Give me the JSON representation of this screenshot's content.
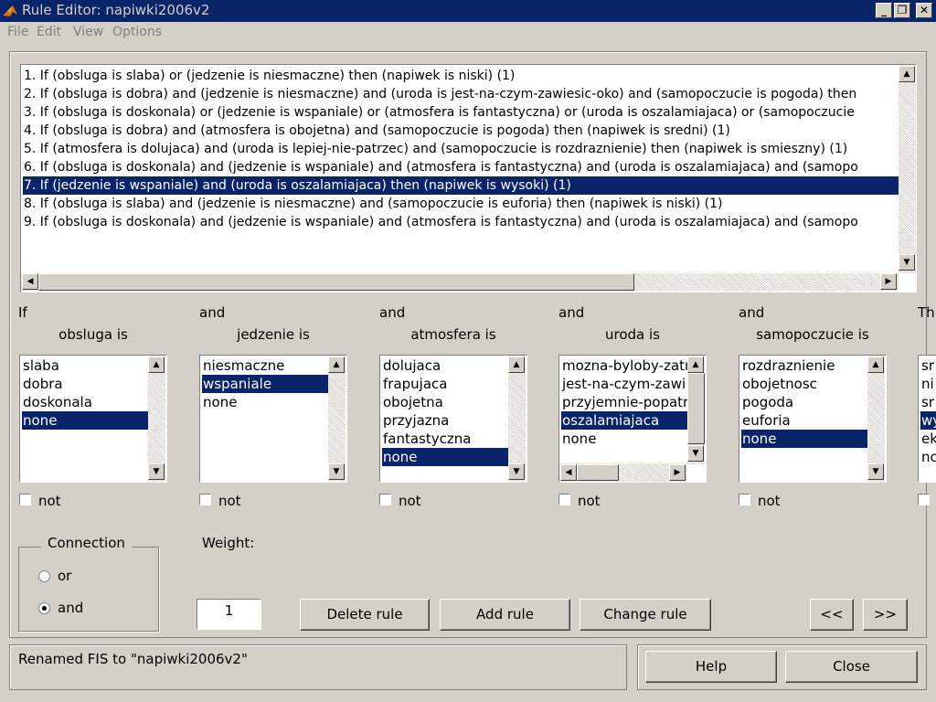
{
  "window": {
    "title": "Rule Editor: napiwki2006v2",
    "controls": [
      "minimize-icon",
      "restore-icon",
      "close-icon"
    ]
  },
  "menu": [
    "File",
    "Edit",
    "View",
    "Options"
  ],
  "rules": [
    "1. If (obsluga is slaba) or (jedzenie is niesmaczne) then (napiwek is niski) (1)",
    "2. If (obsluga is dobra) and (jedzenie is niesmaczne) and (uroda is jest-na-czym-zawiesic-oko) and (samopoczucie is pogoda) then",
    "3. If (obsluga is doskonala) or (jedzenie is wspaniale) or (atmosfera is fantastyczna) or (uroda is oszalamiajaca) or (samopoczucie",
    "4. If (obsluga is dobra) and (atmosfera is obojetna) and (samopoczucie is pogoda) then (napiwek is sredni) (1)",
    "5. If (atmosfera is dolujaca) and (uroda is lepiej-nie-patrzec) and (samopoczucie is rozdraznienie) then (napiwek is smieszny) (1)",
    "6. If (obsluga is doskonala) and (jedzenie is wspaniale) and (atmosfera is fantastyczna) and (uroda is oszalamiajaca) and (samopo",
    "7. If (jedzenie is wspaniale) and (uroda is oszalamiajaca) then (napiwek is wysoki) (1)",
    "8. If (obsluga is slaba) and (jedzenie is niesmaczne) and (samopoczucie is euforia) then (napiwek is niski) (1)",
    "9. If (obsluga is doskonala) and (jedzenie is wspaniale) and (atmosfera is fantastyczna) and (uroda is oszalamiajaca) and (samopo"
  ],
  "selected_rule_index": 6,
  "columns": [
    {
      "conn": "If",
      "label": "obsluga is",
      "options": [
        "slaba",
        "dobra",
        "doskonala",
        "none"
      ],
      "selected": 3,
      "not_label": "not"
    },
    {
      "conn": "and",
      "label": "jedzenie is",
      "options": [
        "niesmaczne",
        "wspaniale",
        "none"
      ],
      "selected": 1,
      "not_label": "not"
    },
    {
      "conn": "and",
      "label": "atmosfera is",
      "options": [
        "dolujaca",
        "frapujaca",
        "obojetna",
        "przyjazna",
        "fantastyczna",
        "none"
      ],
      "selected": 5,
      "not_label": "not"
    },
    {
      "conn": "and",
      "label": "uroda is",
      "options": [
        "mozna-byloby-zatr",
        "jest-na-czym-zawi",
        "przyjemnie-popatrz",
        "oszalamiajaca",
        "none"
      ],
      "selected": 3,
      "not_label": "not"
    },
    {
      "conn": "and",
      "label": "samopoczucie is",
      "options": [
        "rozdraznienie",
        "obojetnosc",
        "pogoda",
        "euforia",
        "none"
      ],
      "selected": 4,
      "not_label": "not"
    },
    {
      "conn": "Th",
      "label": "",
      "options": [
        "sr",
        "ni",
        "sr",
        "wy",
        "ek",
        "nc"
      ],
      "selected": 3,
      "not_label": ""
    }
  ],
  "connection": {
    "title": "Connection",
    "options": [
      {
        "label": "or",
        "checked": false
      },
      {
        "label": "and",
        "checked": true
      }
    ]
  },
  "weight": {
    "label": "Weight:",
    "value": "1"
  },
  "buttons": {
    "delete": "Delete rule",
    "add": "Add rule",
    "change": "Change rule",
    "prev": "<<",
    "next": ">>",
    "help": "Help",
    "close": "Close"
  },
  "status": "Renamed FIS to \"napiwki2006v2\"",
  "colors": {
    "titlebar": "#0a246a",
    "selection": "#0a246a",
    "face": "#d4d0c8"
  }
}
